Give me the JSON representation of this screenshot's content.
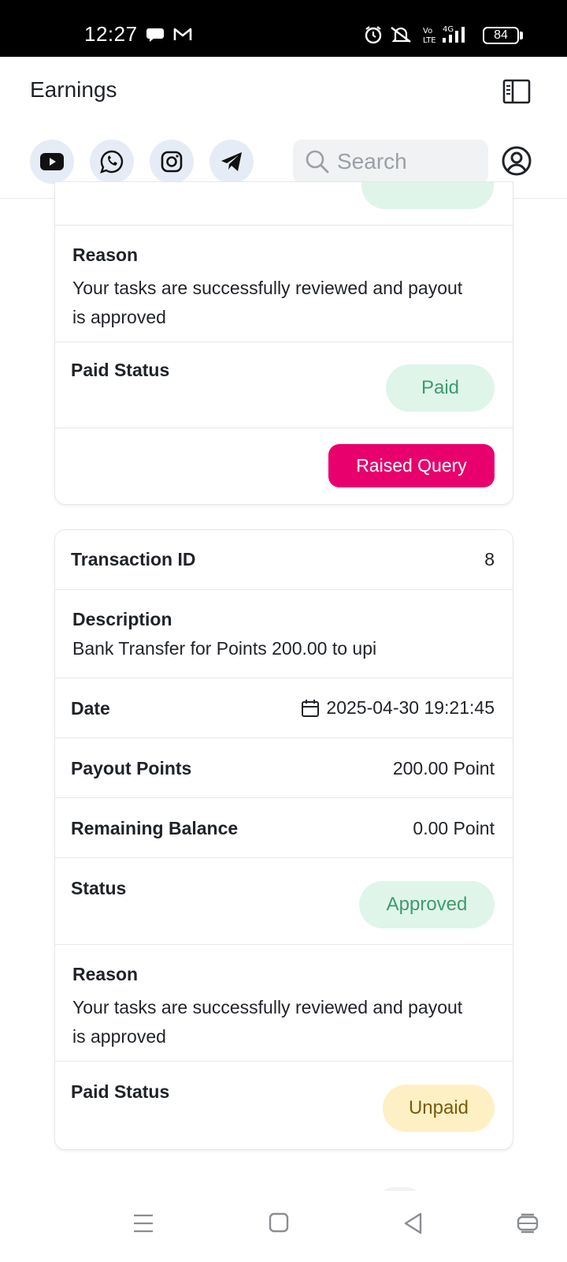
{
  "status_bar": {
    "time": "12:27",
    "battery": "84"
  },
  "header": {
    "title": "Earnings",
    "search_placeholder": "Search",
    "social_icons": [
      "youtube-icon",
      "whatsapp-icon",
      "instagram-icon",
      "telegram-icon"
    ]
  },
  "card1": {
    "reason_label": "Reason",
    "reason_text": "Your tasks are successfully reviewed and payout is approved",
    "paid_status_label": "Paid Status",
    "paid_status_value": "Paid",
    "query_button": "Raised Query"
  },
  "card2": {
    "transaction_id_label": "Transaction ID",
    "transaction_id_value": "8",
    "description_label": "Description",
    "description_text": "Bank Transfer for Points 200.00 to upi",
    "date_label": "Date",
    "date_value": "2025-04-30 19:21:45",
    "payout_label": "Payout Points",
    "payout_value": "200.00 Point",
    "balance_label": "Remaining Balance",
    "balance_value": "0.00 Point",
    "status_label": "Status",
    "status_value": "Approved",
    "reason_label": "Reason",
    "reason_text": "Your tasks are successfully reviewed and payout is approved",
    "paid_status_label": "Paid Status",
    "paid_status_value": "Unpaid"
  },
  "colors": {
    "approved_bg": "#dff5ea",
    "approved_text": "#3f9a6e",
    "unpaid_bg": "#fdf0c4",
    "unpaid_text": "#7a5b0a",
    "query_button": "#e8006d"
  }
}
